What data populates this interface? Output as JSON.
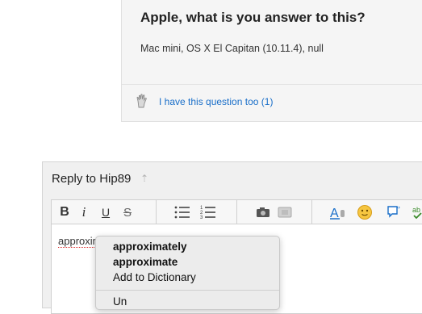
{
  "question": {
    "title": "Apple, what is you answer to this?",
    "meta": "Mac mini, OS X El Capitan (10.11.4), null",
    "me_too_label": "I have this question too (",
    "me_too_count": "1",
    "me_too_close": ")"
  },
  "reply": {
    "title": "Reply to Hip89",
    "editor_text": "approxim"
  },
  "toolbar": {
    "bold": "B",
    "italic": "i",
    "underline": "U",
    "strike": "S"
  },
  "context_menu": {
    "suggestions": [
      "approximately",
      "approximate"
    ],
    "add_to_dictionary": "Add to Dictionary",
    "partial_next": "Un"
  },
  "colors": {
    "link": "#1a6fc9",
    "spell_underline": "#dd3333"
  }
}
